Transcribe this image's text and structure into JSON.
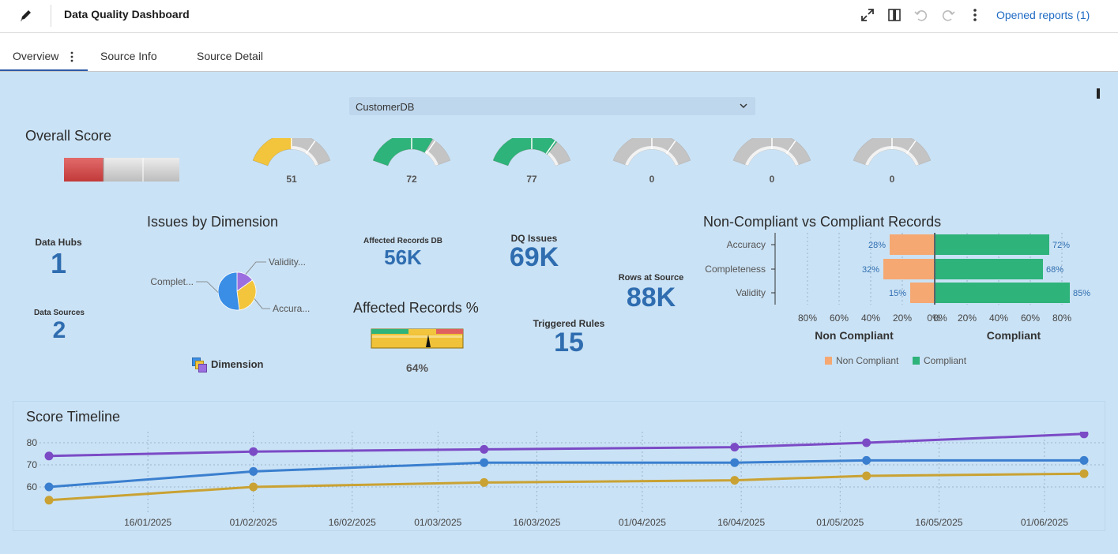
{
  "app": {
    "title": "Data Quality Dashboard",
    "opened_reports": "Opened reports (1)"
  },
  "toolbar": {
    "icons": [
      "pencil-icon",
      "maximize-icon",
      "panel-icon",
      "undo-icon",
      "redo-icon",
      "more-vert-icon"
    ]
  },
  "tabs": [
    {
      "label": "Overview",
      "active": true
    },
    {
      "label": "Source Info"
    },
    {
      "label": "Source Detail"
    }
  ],
  "filter": {
    "selected": "CustomerDB"
  },
  "overall": {
    "title": "Overall Score",
    "gauges": [
      {
        "value": 51,
        "display": "51",
        "color": "#f2c53d"
      },
      {
        "value": 72,
        "display": "72",
        "color": "#2eb37a"
      },
      {
        "value": 77,
        "display": "77",
        "color": "#2eb37a"
      },
      {
        "value": 0,
        "display": "0",
        "color": "#c9c9c9"
      },
      {
        "value": 0,
        "display": "0",
        "color": "#c9c9c9"
      },
      {
        "value": 0,
        "display": "0",
        "color": "#c9c9c9"
      }
    ]
  },
  "kpis": {
    "data_hubs": {
      "label": "Data Hubs",
      "value": "1"
    },
    "data_sources": {
      "label": "Data Sources",
      "value": "2"
    },
    "affected_records_db": {
      "label": "Affected Records DB",
      "value": "56K"
    },
    "dq_issues": {
      "label": "DQ Issues",
      "value": "69K"
    },
    "rows_at_source": {
      "label": "Rows at Source",
      "value": "88K"
    },
    "triggered_rules": {
      "label": "Triggered Rules",
      "value": "15"
    }
  },
  "affected_pct": {
    "title": "Affected Records %",
    "value": 64,
    "display": "64%"
  },
  "issues_by_dimension": {
    "title": "Issues by Dimension",
    "legend_title": "Dimension",
    "slices": [
      {
        "label": "Validity...",
        "value": 15,
        "color": "#9b6fe0"
      },
      {
        "label": "Accura...",
        "value": 33,
        "color": "#f2c53d"
      },
      {
        "label": "Complet...",
        "value": 52,
        "color": "#3a8ee6"
      }
    ]
  },
  "compliance": {
    "title": "Non-Compliant vs Compliant Records",
    "categories": [
      "Accuracy",
      "Completeness",
      "Validity"
    ],
    "non_compliant": [
      28,
      32,
      15
    ],
    "compliant": [
      72,
      68,
      85
    ],
    "non_compliant_labels": [
      "28%",
      "32%",
      "15%"
    ],
    "compliant_labels": [
      "72%",
      "68%",
      "85%"
    ],
    "left_ticks": [
      "80%",
      "60%",
      "40%",
      "20%",
      "0%"
    ],
    "right_ticks": [
      "0%",
      "20%",
      "40%",
      "60%",
      "80%"
    ],
    "left_axis_title": "Non Compliant",
    "right_axis_title": "Compliant",
    "legend": [
      "Non Compliant",
      "Compliant"
    ],
    "colors": {
      "non_compliant": "#f5a872",
      "compliant": "#2eb37a"
    }
  },
  "chart_data": {
    "type": "line",
    "title": "Score Timeline",
    "xlabel": "",
    "ylabel": "",
    "x": [
      "2025-01-01",
      "2025-02-01",
      "2025-03-08",
      "2025-04-15",
      "2025-05-05",
      "2025-06-07"
    ],
    "series": [
      {
        "values": [
          74,
          76,
          77,
          78,
          80,
          84
        ],
        "color": "#7b4bc6"
      },
      {
        "values": [
          60,
          67,
          71,
          71,
          72,
          72
        ],
        "color": "#3a7fcf"
      },
      {
        "values": [
          54,
          60,
          62,
          63,
          65,
          66
        ],
        "color": "#c9a233"
      }
    ],
    "yticks": [
      "80",
      "70",
      "60"
    ],
    "ylim": [
      50,
      85
    ],
    "xticks": [
      "16/01/2025",
      "01/02/2025",
      "16/02/2025",
      "01/03/2025",
      "16/03/2025",
      "01/04/2025",
      "16/04/2025",
      "01/05/2025",
      "16/05/2025",
      "01/06/2025"
    ],
    "xtick_dates": [
      "2025-01-16",
      "2025-02-01",
      "2025-02-16",
      "2025-03-01",
      "2025-03-16",
      "2025-04-01",
      "2025-04-16",
      "2025-05-01",
      "2025-05-16",
      "2025-06-01"
    ],
    "grid": true
  }
}
